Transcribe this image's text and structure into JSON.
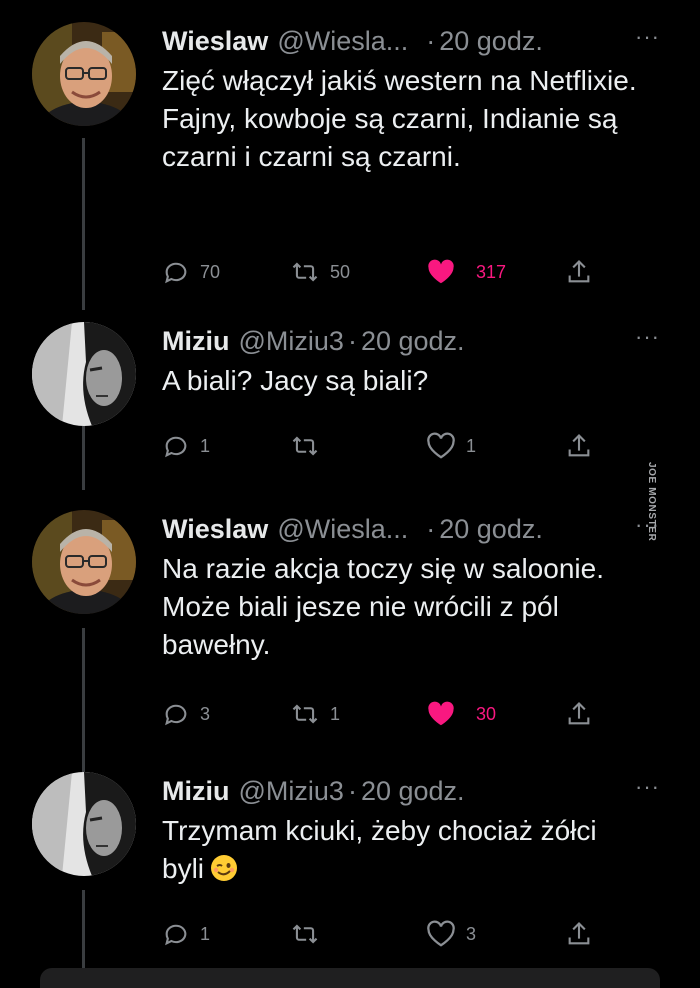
{
  "watermark": "JOE MONSTER",
  "colors": {
    "background": "#000000",
    "text": "#e7e9ea",
    "muted": "#8b8f94",
    "like": "#f91880"
  },
  "tweets": [
    {
      "name": "Wieslaw",
      "handle": "@Wiesla...",
      "separator": "·",
      "time": "20 godz.",
      "more": "···",
      "text": "Zięć włączył jakiś western na Netflixie. Fajny, kowboje są czarni, Indianie są czarni i czarni są czarni.",
      "replies": "70",
      "retweets": "50",
      "likes": "317",
      "liked": true,
      "avatar_icon": "avatar-photo-older-man-glasses"
    },
    {
      "name": "Miziu",
      "handle": "@Miziu3",
      "separator": "·",
      "time": "20 godz.",
      "more": "···",
      "text": "A biali? Jacy są biali?",
      "replies": "1",
      "retweets": "",
      "likes": "1",
      "liked": false,
      "avatar_icon": "avatar-photo-bw-portrait"
    },
    {
      "name": "Wieslaw",
      "handle": "@Wiesla...",
      "separator": "·",
      "time": "20 godz.",
      "more": "···",
      "text": "Na razie akcja toczy się w saloonie. Może biali jesze nie wrócili z pól bawełny.",
      "replies": "3",
      "retweets": "1",
      "likes": "30",
      "liked": true,
      "avatar_icon": "avatar-photo-older-man-glasses"
    },
    {
      "name": "Miziu",
      "handle": "@Miziu3",
      "separator": "·",
      "time": "20 godz.",
      "more": "···",
      "text": "Trzymam kciuki, żeby chociaż żółci byli",
      "emoji": "winking-face-emoji",
      "replies": "1",
      "retweets": "",
      "likes": "3",
      "liked": false,
      "avatar_icon": "avatar-photo-bw-portrait"
    }
  ]
}
